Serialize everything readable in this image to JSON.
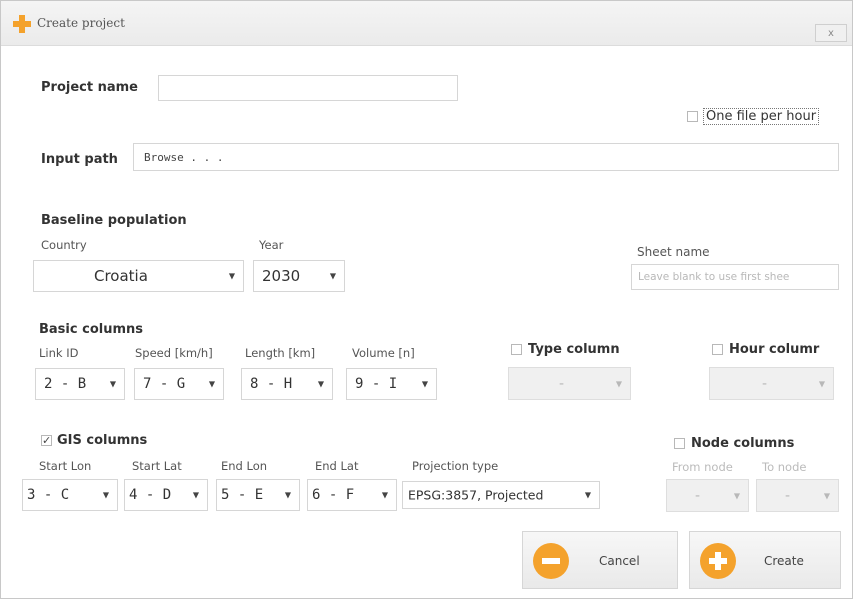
{
  "window": {
    "title": "Create project",
    "close_label": "x"
  },
  "project_name": {
    "label": "Project name",
    "value": ""
  },
  "one_file_per_hour": {
    "label": "One file per hour",
    "checked": false
  },
  "input_path": {
    "label": "Input path",
    "value": "Browse . . ."
  },
  "baseline": {
    "heading": "Baseline population",
    "country_label": "Country",
    "country_value": "Croatia",
    "year_label": "Year",
    "year_value": "2030",
    "sheet_label": "Sheet name",
    "sheet_placeholder": "Leave blank to use first shee"
  },
  "basic_columns": {
    "heading": "Basic columns",
    "fields": [
      {
        "label": "Link ID",
        "value": "2 - B"
      },
      {
        "label": "Speed [km/h]",
        "value": "7 - G"
      },
      {
        "label": "Length [km]",
        "value": "8 - H"
      },
      {
        "label": "Volume [n]",
        "value": "9 - I"
      }
    ]
  },
  "type_column": {
    "label": "Type column",
    "checked": false,
    "value": "-"
  },
  "hour_column": {
    "label": "Hour columr",
    "checked": false,
    "value": "-"
  },
  "gis_columns": {
    "heading": "GIS columns",
    "checked": true,
    "fields": [
      {
        "label": "Start Lon",
        "value": "3 - C"
      },
      {
        "label": "Start Lat",
        "value": "4 - D"
      },
      {
        "label": "End Lon",
        "value": "5 - E"
      },
      {
        "label": "End Lat",
        "value": "6 - F"
      },
      {
        "label": "Projection type",
        "value": "EPSG:3857, Projected"
      }
    ]
  },
  "node_columns": {
    "heading": "Node columns",
    "checked": false,
    "from_label": "From node",
    "to_label": "To node",
    "from_value": "-",
    "to_value": "-"
  },
  "buttons": {
    "cancel": "Cancel",
    "create": "Create"
  },
  "colors": {
    "accent": "#f4a22c",
    "border": "#d6d6d6"
  }
}
